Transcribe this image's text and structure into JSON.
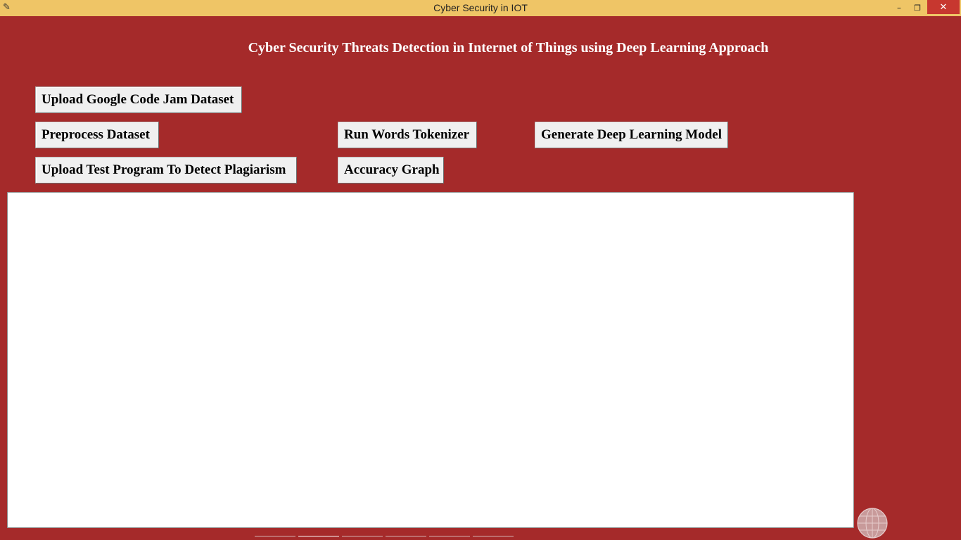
{
  "window": {
    "title": "Cyber Security in IOT",
    "minimize_glyph": "–",
    "maximize_glyph": "❐",
    "close_glyph": "✕",
    "app_icon": "feather-icon"
  },
  "heading": "Cyber Security Threats Detection in Internet of Things using Deep Learning Approach",
  "buttons": {
    "upload_dataset": "Upload Google Code Jam Dataset",
    "preprocess": "Preprocess Dataset",
    "tokenizer": "Run Words Tokenizer",
    "generate_model": "Generate Deep Learning Model",
    "upload_test": "Upload Test Program To Detect Plagiarism",
    "accuracy": "Accuracy Graph"
  },
  "output": {
    "text": ""
  },
  "colors": {
    "background": "#a52a2a",
    "titlebar": "#efc566",
    "button_face": "#f0f0f0",
    "output_bg": "#ffffff",
    "close_button": "#c7372f"
  },
  "icons": {
    "corner_widget": "globe-icon"
  }
}
